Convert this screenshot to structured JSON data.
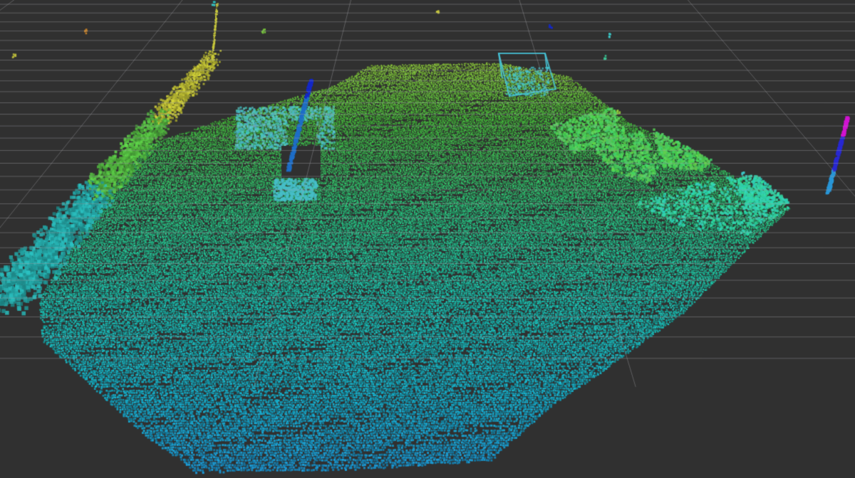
{
  "viewport": {
    "background_color": "#303030",
    "grid_color": "#a0a0a4",
    "grid_visible": true
  },
  "point_cloud": {
    "color_scale": [
      "#2090ff",
      "#12b4c8",
      "#18c8a0",
      "#30c850",
      "#8cc83c",
      "#c8c840",
      "#1428c8",
      "#c814d2"
    ],
    "colored_by": "height",
    "objects": [
      "floor-plane",
      "left-wall",
      "upper-left-structure",
      "right-floor-regions",
      "box-frame",
      "pole",
      "right-post"
    ]
  }
}
